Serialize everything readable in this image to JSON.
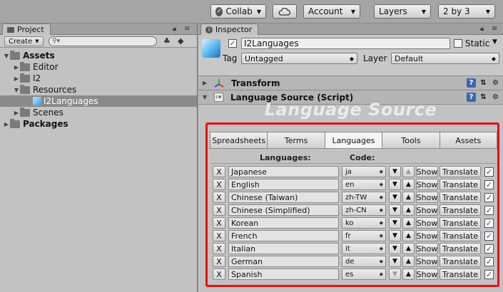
{
  "toolbar": {
    "collab": "Collab",
    "cloud_icon": "cloud-icon",
    "account": "Account",
    "layers": "Layers",
    "layout": "2 by 3"
  },
  "project": {
    "tab_label": "Project",
    "create_label": "Create",
    "search_placeholder": "",
    "tree": [
      {
        "label": "Assets",
        "bold": true
      },
      {
        "label": "Editor"
      },
      {
        "label": "I2"
      },
      {
        "label": "Resources"
      },
      {
        "label": "I2Languages",
        "selected": true
      },
      {
        "label": "Scenes"
      },
      {
        "label": "Packages",
        "bold": true
      }
    ]
  },
  "inspector": {
    "tab_label": "Inspector",
    "object_name": "I2Languages",
    "static_label": "Static",
    "tag_label": "Tag",
    "tag_value": "Untagged",
    "layer_label": "Layer",
    "layer_value": "Default",
    "components": [
      "Transform",
      "Language Source (Script)"
    ],
    "title": "Language Source",
    "tabs": [
      "Spreadsheets",
      "Terms",
      "Languages",
      "Tools",
      "Assets"
    ],
    "active_tab": "Languages",
    "col_languages": "Languages:",
    "col_code": "Code:",
    "row_remove": "X",
    "row_show": "Show",
    "row_translate": "Translate",
    "languages": [
      {
        "name": "Japanese",
        "code": "ja"
      },
      {
        "name": "English",
        "code": "en"
      },
      {
        "name": "Chinese (Taiwan)",
        "code": "zh-TW"
      },
      {
        "name": "Chinese (Simplified)",
        "code": "zh-CN"
      },
      {
        "name": "Korean",
        "code": "ko"
      },
      {
        "name": "French",
        "code": "fr"
      },
      {
        "name": "Italian",
        "code": "it"
      },
      {
        "name": "German",
        "code": "de"
      },
      {
        "name": "Spanish",
        "code": "es"
      }
    ]
  },
  "colors": {
    "highlight": "#e31212",
    "title": "#ebebeb"
  }
}
